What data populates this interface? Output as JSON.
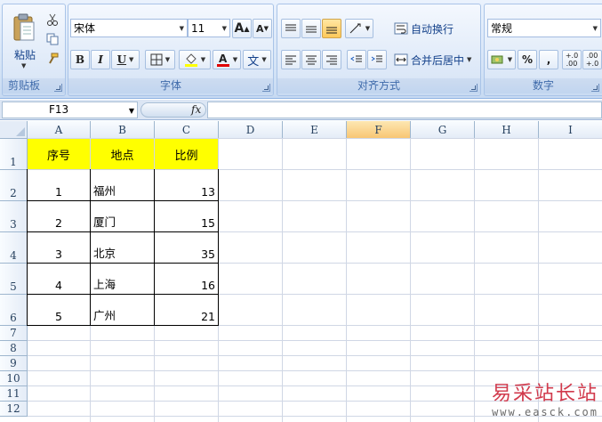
{
  "ribbon": {
    "clipboard": {
      "title": "剪贴板",
      "paste_label": "粘贴"
    },
    "font": {
      "title": "字体",
      "font_name": "宋体",
      "font_size": "11",
      "bold": "B",
      "italic": "I",
      "underline": "U",
      "grow": "A",
      "shrink": "A",
      "phonetic": "文"
    },
    "alignment": {
      "title": "对齐方式",
      "wrap_text": "自动换行",
      "merge_center": "合并后居中"
    },
    "number": {
      "title": "数字",
      "format": "常规",
      "percent": "%",
      "comma": ",",
      "increase_decimal": "+.0 .00",
      "decrease_decimal": ".00 +.0"
    }
  },
  "formula_bar": {
    "name_box": "F13",
    "fx": "fx",
    "formula": ""
  },
  "grid": {
    "columns": [
      "A",
      "B",
      "C",
      "D",
      "E",
      "F",
      "G",
      "H",
      "I"
    ],
    "selected_column": "F",
    "rows": [
      "1",
      "2",
      "3",
      "4",
      "5",
      "6",
      "7",
      "8",
      "9",
      "10",
      "11",
      "12"
    ],
    "headers": [
      "序号",
      "地点",
      "比例"
    ],
    "data": [
      {
        "num": "1",
        "place": "福州",
        "ratio": "13"
      },
      {
        "num": "2",
        "place": "厦门",
        "ratio": "15"
      },
      {
        "num": "3",
        "place": "北京",
        "ratio": "35"
      },
      {
        "num": "4",
        "place": "上海",
        "ratio": "16"
      },
      {
        "num": "5",
        "place": "广州",
        "ratio": "21"
      }
    ]
  },
  "watermark": {
    "title": "易采站长站",
    "url": "www.easck.com"
  },
  "colors": {
    "header_fill": "#ffff00",
    "selected_col": "#f8c674",
    "ribbon_text": "#15428b"
  }
}
